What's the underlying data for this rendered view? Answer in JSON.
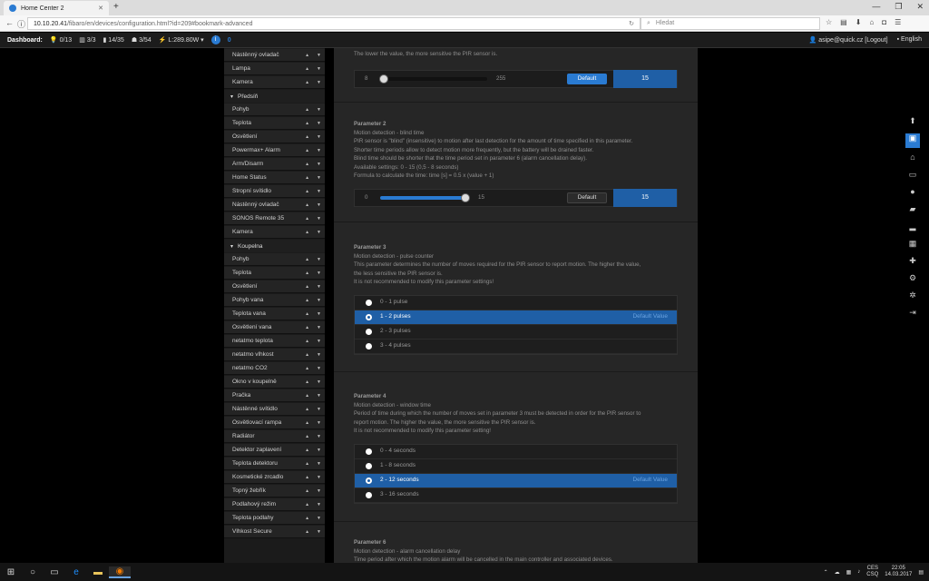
{
  "browser": {
    "tab_title": "Home Center 2",
    "url_host": "10.10.20.41",
    "url_path": "/fibaro/en/devices/configuration.html?id=209#bookmark-advanced",
    "search_placeholder": "Hledat"
  },
  "dashbar": {
    "label": "Dashboard:",
    "stats": [
      "0/13",
      "3/3",
      "14/35",
      "3/54",
      "L:289.80W"
    ],
    "info_badge": "0",
    "user": "asipe@quick.cz [Logout]",
    "language": "English"
  },
  "sidebar": {
    "items": [
      {
        "type": "item",
        "label": "Nástěnný ovladač"
      },
      {
        "type": "item",
        "label": "Lampa"
      },
      {
        "type": "item",
        "label": "Kamera"
      },
      {
        "type": "head",
        "label": "Předsíň"
      },
      {
        "type": "item",
        "label": "Pohyb"
      },
      {
        "type": "item",
        "label": "Teplota"
      },
      {
        "type": "item",
        "label": "Osvětlení"
      },
      {
        "type": "item",
        "label": "Powermax+ Alarm"
      },
      {
        "type": "item",
        "label": "Arm/Disarm"
      },
      {
        "type": "item",
        "label": "Home Status"
      },
      {
        "type": "item",
        "label": "Stropní svítidlo"
      },
      {
        "type": "item",
        "label": "Nástěnný ovladač"
      },
      {
        "type": "item",
        "label": "SONOS Remote 35"
      },
      {
        "type": "item",
        "label": "Kamera"
      },
      {
        "type": "head",
        "label": "Koupelna"
      },
      {
        "type": "item",
        "label": "Pohyb"
      },
      {
        "type": "item",
        "label": "Teplota"
      },
      {
        "type": "item",
        "label": "Osvětlení"
      },
      {
        "type": "item",
        "label": "Pohyb vana"
      },
      {
        "type": "item",
        "label": "Teplota vana"
      },
      {
        "type": "item",
        "label": "Osvětlení vana"
      },
      {
        "type": "item",
        "label": "netatmo teplota"
      },
      {
        "type": "item",
        "label": "netatmo vlhkost"
      },
      {
        "type": "item",
        "label": "netatmo CO2"
      },
      {
        "type": "item",
        "label": "Okno v koupelně"
      },
      {
        "type": "item",
        "label": "Pračka"
      },
      {
        "type": "item",
        "label": "Nástěnné svítidlo"
      },
      {
        "type": "item",
        "label": "Osvětlovací rampa"
      },
      {
        "type": "item",
        "label": "Radiátor"
      },
      {
        "type": "item",
        "label": "Detektor zaplavení"
      },
      {
        "type": "item",
        "label": "Teplota detektoru"
      },
      {
        "type": "item",
        "label": "Kosmetické zrcadlo"
      },
      {
        "type": "item",
        "label": "Topný žebřík"
      },
      {
        "type": "item",
        "label": "Podlahový režim"
      },
      {
        "type": "item",
        "label": "Teplota podlahy"
      },
      {
        "type": "item",
        "label": "Vlhkost Secure"
      }
    ]
  },
  "params": {
    "p1": {
      "desc": "The lower the value, the more sensitive the PIR sensor is.",
      "min": "8",
      "max": "255",
      "value": "15",
      "fraction": 0.03,
      "default_label": "Default"
    },
    "p2": {
      "title": "Parameter 2",
      "lines": [
        "Motion detection - blind time",
        "PIR sensor is \"blind\" (insensitive) to motion after last detection for the amount of time specified in this parameter.",
        "Shorter time periods allow to detect motion more frequently, but the battery will be drained faster.",
        "Blind time should be shorter that the time period set in parameter 6 (alarm cancellation delay).",
        "Available settings: 0 - 15 (0,5 - 8 seconds)",
        "Formula to calculate the time: time [s] = 0.5 x (value + 1)"
      ],
      "min": "0",
      "max": "15",
      "value": "15",
      "fraction": 1.0,
      "default_label": "Default"
    },
    "p3": {
      "title": "Parameter 3",
      "lines": [
        "Motion detection - pulse counter",
        "This parameter determines the number of moves required for the PIR sensor to report motion. The higher the value,",
        "the less sensitive the PIR sensor is.",
        "It is not recommended to modify this parameter settings!"
      ],
      "options": [
        "0 - 1 pulse",
        "1 - 2 pulses",
        "2 - 3 pulses",
        "3 - 4 pulses"
      ],
      "selected": 1,
      "default_value_label": "Default Value"
    },
    "p4": {
      "title": "Parameter 4",
      "lines": [
        "Motion detection - window time",
        "Period of time during which the number of moves set in parameter 3 must be detected in order for the PIR sensor to",
        "report motion. The higher the value, the more sensitive the PIR sensor is.",
        "It is not recommended to modify this parameter setting!"
      ],
      "options": [
        "0 - 4 seconds",
        "1 - 8 seconds",
        "2 - 12 seconds",
        "3 - 16 seconds"
      ],
      "selected": 2,
      "default_value_label": "Default Value"
    },
    "p6": {
      "title": "Parameter 6",
      "lines": [
        "Motion detection - alarm cancellation delay",
        "Time period after which the motion alarm will be cancelled in the main controller and associated devices."
      ]
    }
  },
  "taskbar": {
    "lang": "CES",
    "lang2": "CSQ",
    "time": "22:05",
    "date": "14.03.2017"
  }
}
